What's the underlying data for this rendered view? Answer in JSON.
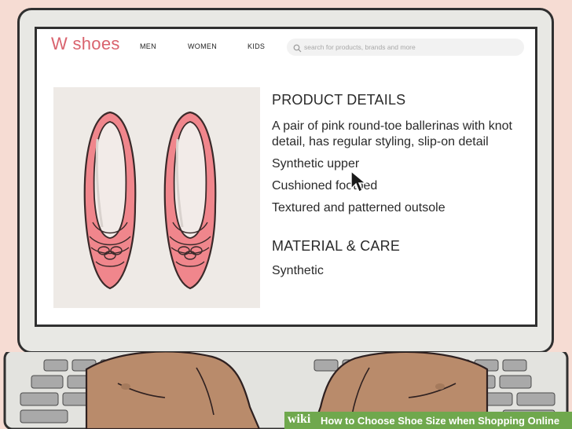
{
  "site": {
    "logo": "W shoes",
    "nav": [
      "MEN",
      "WOMEN",
      "KIDS"
    ],
    "search": {
      "placeholder": "search for products, brands and more",
      "icon": "search-icon"
    }
  },
  "product": {
    "details_title": "PRODUCT DETAILS",
    "description": "A pair of pink round-toe ballerinas with knot detail, has regular styling, slip-on detail",
    "features": [
      "Synthetic upper",
      "Cushioned footbed",
      "Textured and patterned outsole"
    ],
    "material_title": "MATERIAL & CARE",
    "material": "Synthetic"
  },
  "watermark": {
    "brand": "wiki",
    "title": "How to Choose Shoe Size when Shopping Online"
  },
  "colors": {
    "logo": "#d9636e",
    "shoe_pink": "#f0868c",
    "background": "#f6dcd3",
    "watermark_green": "#6fa84d"
  }
}
